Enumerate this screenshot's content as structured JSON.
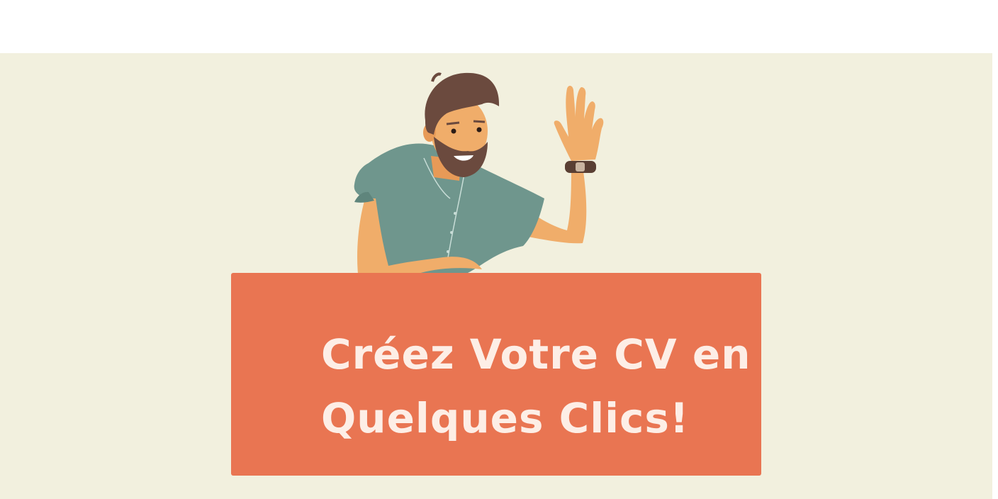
{
  "hero": {
    "headline_line1": "Créez Votre CV en",
    "headline_line2": "Quelques Clics!",
    "illustration_icon": "waving-man-illustration"
  },
  "colors": {
    "page_background": "#ffffff",
    "hero_background": "#f2f0de",
    "banner": "#e97552",
    "headline_text": "#fdeee6",
    "shirt": "#6f968d",
    "skin": "#f0ad6a",
    "hair": "#6b4a3e"
  }
}
